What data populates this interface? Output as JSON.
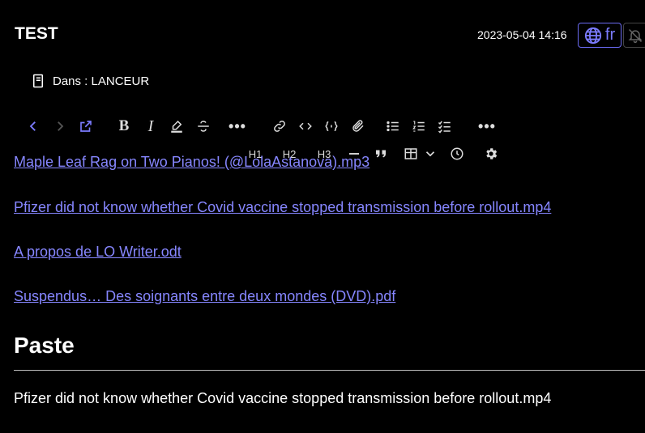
{
  "header": {
    "title": "TEST",
    "date": "2023-05-04 14:16",
    "language": "fr"
  },
  "notebook": {
    "label": "Dans : LANCEUR"
  },
  "toolbar": {
    "bold": "B",
    "italic": "I",
    "more": "•••",
    "h1": "H1",
    "h2": "H2",
    "h3": "H3"
  },
  "links": [
    "Maple Leaf Rag on Two Pianos! (@LolaAstanova).mp3",
    "Pfizer did not know whether Covid vaccine stopped transmission before rollout.mp4",
    "A propos de LO Writer.odt",
    "Suspendus… Des soignants entre deux mondes (DVD).pdf"
  ],
  "heading": "Paste",
  "paragraph": "Pfizer did not know whether Covid vaccine stopped transmission before rollout.mp4",
  "colors": {
    "accent": "#6b6bf2",
    "link": "#8686ff",
    "background": "#000000"
  }
}
